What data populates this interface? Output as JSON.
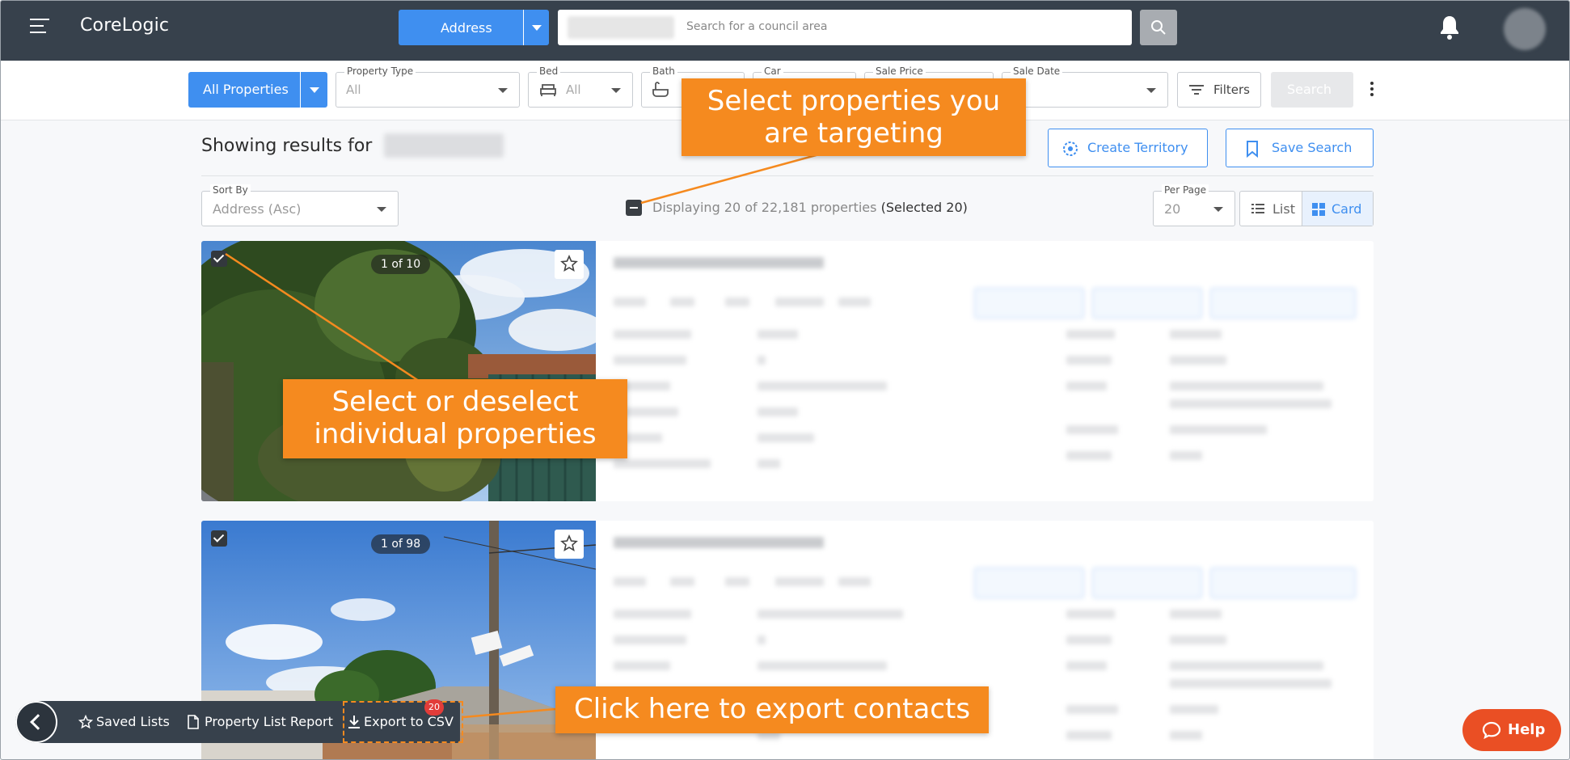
{
  "header": {
    "brand": "CoreLogic",
    "search_type": "Address",
    "search_placeholder": "Search for a council area"
  },
  "filters": {
    "all_properties": "All Properties",
    "property_type": {
      "label": "Property Type",
      "value": "All"
    },
    "bed": {
      "label": "Bed",
      "value": "All"
    },
    "bath": {
      "label": "Bath",
      "value": ""
    },
    "car": {
      "label": "Car",
      "value": ""
    },
    "sale_price": {
      "label": "Sale Price",
      "value": ""
    },
    "sale_date": {
      "label": "Sale Date",
      "value": ""
    },
    "filters_button": "Filters",
    "search_button": "Search"
  },
  "results": {
    "showing_label": "Showing results for",
    "create_territory": "Create Territory",
    "save_search": "Save Search",
    "sort_by": {
      "label": "Sort By",
      "value": "Address (Asc)"
    },
    "displaying_text": "Displaying 20 of 22,181 properties",
    "selected_text": "(Selected 20)",
    "per_page": {
      "label": "Per Page",
      "value": "20"
    },
    "view_list": "List",
    "view_card": "Card",
    "cards": [
      {
        "photo_counter": "1 of 10",
        "selected": true
      },
      {
        "photo_counter": "1 of 98",
        "selected": true
      }
    ]
  },
  "bottom_bar": {
    "saved_lists": "Saved Lists",
    "property_list_report": "Property List Report",
    "export_csv": "Export to CSV",
    "export_count": "20"
  },
  "help_label": "Help",
  "callouts": {
    "select_targeting": "Select properties you are targeting",
    "select_individual": "Select or deselect individual properties",
    "export_contacts": "Click here to export contacts"
  },
  "colors": {
    "topbar": "#37414c",
    "primary": "#3f8ff0",
    "callout": "#f58a1f",
    "help": "#ea4f24",
    "badge": "#e23c39"
  }
}
